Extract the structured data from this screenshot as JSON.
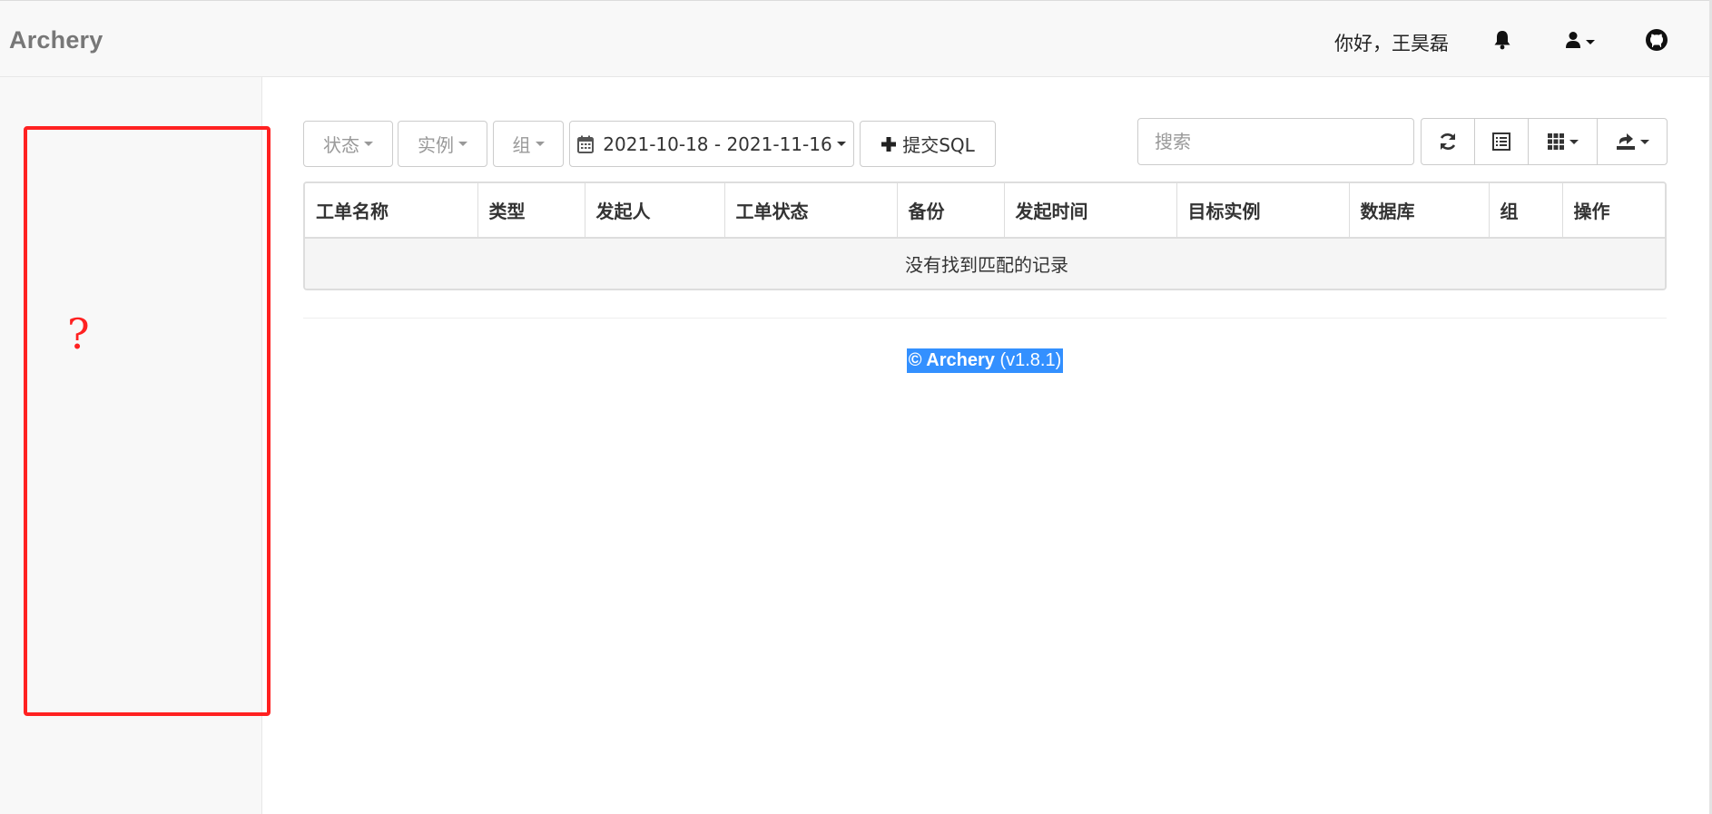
{
  "navbar": {
    "brand": "Archery",
    "greeting": "你好，王昊磊",
    "icons": [
      "bell-icon",
      "user-icon",
      "github-icon"
    ]
  },
  "sidebar": {
    "placeholder_mark": "?",
    "highlight_color": "#ff2121"
  },
  "toolbar": {
    "status_label": "状态",
    "instance_label": "实例",
    "group_label": "组",
    "date_range": "2021-10-18 - 2021-11-16",
    "submit_label": "提交SQL",
    "search_placeholder": "搜索",
    "tool_icons": [
      "refresh-icon",
      "list-icon",
      "columns-icon",
      "export-icon"
    ]
  },
  "table": {
    "columns": [
      "工单名称",
      "类型",
      "发起人",
      "工单状态",
      "备份",
      "发起时间",
      "目标实例",
      "数据库",
      "组",
      "操作"
    ],
    "empty_message": "没有找到匹配的记录"
  },
  "footer": {
    "copyright": "© Archery",
    "version": "(v1.8.1)"
  },
  "colors": {
    "navbar_bg": "#f8f8f8",
    "selection": "#3390ff",
    "annotation": "#ff2121"
  }
}
